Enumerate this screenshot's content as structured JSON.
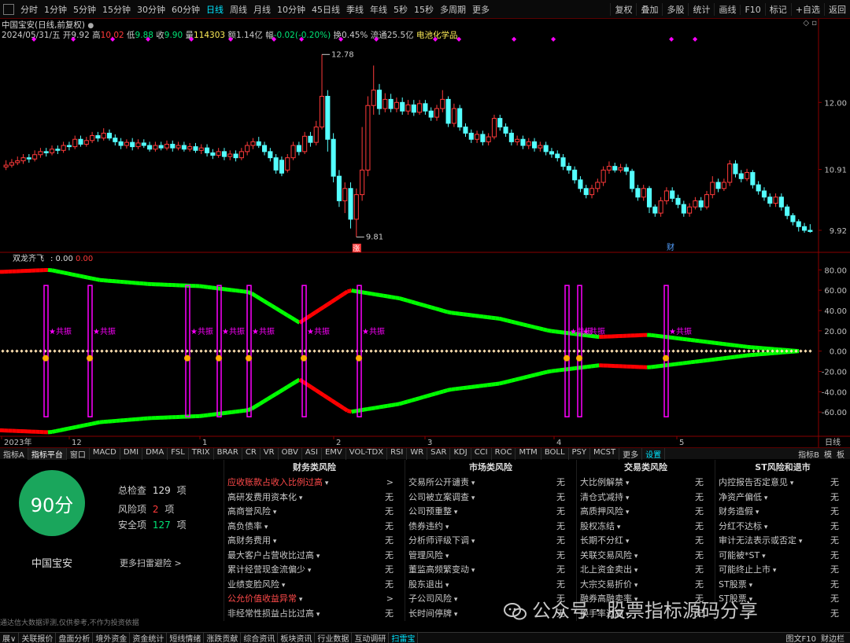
{
  "colors": {
    "up": "#ff3a3a",
    "down": "#54ffff",
    "red_line": "#ff0000",
    "green_line": "#00ff00",
    "magenta": "#ff00ff",
    "score_green": "#1aa65c",
    "orange": "#ffaa00",
    "cyan": "#00e5ff"
  },
  "topbar": {
    "periods": [
      "分时",
      "1分钟",
      "5分钟",
      "15分钟",
      "30分钟",
      "60分钟",
      "日线",
      "周线",
      "月线",
      "10分钟",
      "45日线",
      "季线",
      "年线",
      "5秒",
      "15秒",
      "多周期",
      "更多"
    ],
    "active": "日线",
    "right": [
      "复权",
      "叠加",
      "多股",
      "统计",
      "画线",
      "F10",
      "标记",
      "+自选",
      "返回"
    ]
  },
  "info": {
    "title": "中国宝安(日线,前复权)",
    "date": "2024/05/31/五",
    "open_label": "开",
    "open": "9.92",
    "high_label": "高",
    "high": "10.02",
    "low_label": "低",
    "low": "9.88",
    "close_label": "收",
    "close": "9.90",
    "vol_label": "量",
    "vol": "114303",
    "amount_label": "额",
    "amount": "1.14亿",
    "change_label": "幅",
    "change": "-0.02(-0.20%)",
    "turnover_label": "换",
    "turnover": "0.45%",
    "float_label": "流通",
    "float": "25.5亿",
    "sector": "电池化学品"
  },
  "price_axis": [
    "12.00",
    "10.91",
    "9.92"
  ],
  "price_marks": {
    "high": "12.78",
    "low": "9.81",
    "low_tag": "涨",
    "fin_tag": "财"
  },
  "indicator": {
    "name": "双龙齐飞",
    "value1": "0.00",
    "value2": "0.00",
    "resonance_label": "共振",
    "axis": [
      "80.00",
      "60.00",
      "40.00",
      "20.00",
      "0.00",
      "-20.00",
      "-40.00",
      "-60.00"
    ]
  },
  "time_axis": {
    "labels": [
      "2023年",
      "12",
      "1",
      "2",
      "3",
      "4",
      "5"
    ],
    "right_label": "日线"
  },
  "chart_data": {
    "type": "candlestick",
    "title": "中国宝安(日线,前复权)",
    "ylim": [
      9.6,
      12.95
    ],
    "high_marker": 12.78,
    "low_marker": 9.81,
    "candles": [
      [
        10.95,
        10.98,
        11.06,
        10.9
      ],
      [
        10.98,
        11.02,
        11.08,
        10.94
      ],
      [
        11.02,
        11.05,
        11.12,
        10.98
      ],
      [
        11.05,
        11.1,
        11.16,
        11.0
      ],
      [
        11.1,
        11.08,
        11.16,
        11.02
      ],
      [
        11.08,
        11.15,
        11.22,
        11.04
      ],
      [
        11.15,
        11.2,
        11.26,
        11.1
      ],
      [
        11.2,
        11.18,
        11.26,
        11.12
      ],
      [
        11.18,
        11.24,
        11.3,
        11.14
      ],
      [
        11.24,
        11.22,
        11.3,
        11.16
      ],
      [
        11.22,
        11.3,
        11.36,
        11.18
      ],
      [
        11.3,
        11.28,
        11.36,
        11.22
      ],
      [
        11.28,
        11.4,
        11.46,
        11.24
      ],
      [
        11.4,
        11.32,
        11.46,
        11.28
      ],
      [
        11.32,
        11.38,
        11.44,
        11.28
      ],
      [
        11.38,
        11.46,
        11.52,
        11.34
      ],
      [
        11.46,
        11.42,
        11.52,
        11.36
      ],
      [
        11.42,
        11.5,
        11.58,
        11.38
      ],
      [
        11.5,
        11.42,
        11.56,
        11.38
      ],
      [
        11.42,
        11.36,
        11.48,
        11.3
      ],
      [
        11.36,
        11.3,
        11.42,
        11.24
      ],
      [
        11.3,
        11.35,
        11.4,
        11.25
      ],
      [
        11.35,
        11.28,
        11.42,
        11.22
      ],
      [
        11.28,
        11.34,
        11.4,
        11.24
      ],
      [
        11.34,
        11.3,
        11.4,
        11.26
      ],
      [
        11.3,
        11.24,
        11.36,
        11.2
      ],
      [
        11.24,
        11.3,
        11.36,
        11.2
      ],
      [
        11.3,
        11.26,
        11.36,
        11.22
      ],
      [
        11.26,
        11.32,
        11.38,
        11.22
      ],
      [
        11.32,
        11.26,
        11.38,
        11.2
      ],
      [
        11.26,
        11.3,
        11.36,
        11.22
      ],
      [
        11.3,
        11.24,
        11.36,
        11.2
      ],
      [
        11.24,
        11.28,
        11.34,
        11.2
      ],
      [
        11.28,
        11.22,
        11.34,
        11.18
      ],
      [
        11.22,
        11.26,
        11.32,
        11.16
      ],
      [
        11.26,
        11.18,
        11.32,
        11.12
      ],
      [
        11.18,
        11.14,
        11.24,
        11.08
      ],
      [
        11.14,
        11.2,
        11.26,
        11.1
      ],
      [
        11.2,
        11.12,
        11.26,
        11.06
      ],
      [
        11.12,
        11.16,
        11.22,
        11.06
      ],
      [
        11.16,
        11.1,
        11.22,
        11.04
      ],
      [
        11.1,
        11.2,
        11.26,
        11.06
      ],
      [
        11.2,
        11.3,
        11.36,
        11.14
      ],
      [
        11.3,
        11.36,
        11.42,
        11.24
      ],
      [
        11.36,
        11.3,
        11.44,
        11.26
      ],
      [
        11.3,
        11.2,
        11.36,
        11.14
      ],
      [
        11.2,
        11.1,
        11.26,
        11.04
      ],
      [
        11.1,
        10.9,
        11.16,
        10.84
      ],
      [
        11.06,
        10.85,
        11.12,
        10.8
      ],
      [
        10.9,
        11.1,
        11.16,
        10.86
      ],
      [
        11.1,
        11.3,
        11.36,
        11.06
      ],
      [
        11.3,
        11.2,
        11.36,
        11.14
      ],
      [
        11.2,
        11.45,
        11.52,
        11.16
      ],
      [
        11.45,
        11.35,
        11.52,
        11.28
      ],
      [
        11.35,
        11.6,
        11.7,
        11.3
      ],
      [
        11.6,
        12.1,
        12.78,
        11.56
      ],
      [
        12.1,
        11.4,
        12.2,
        11.2
      ],
      [
        11.4,
        10.8,
        11.5,
        10.7
      ],
      [
        10.8,
        10.4,
        10.9,
        10.3
      ],
      [
        10.4,
        10.6,
        10.7,
        10.2
      ],
      [
        10.6,
        10.1,
        10.7,
        9.95
      ],
      [
        10.1,
        10.5,
        10.6,
        9.81
      ],
      [
        10.5,
        10.9,
        11.6,
        10.4
      ],
      [
        10.9,
        11.95,
        12.1,
        10.8
      ],
      [
        11.95,
        12.2,
        12.6,
        11.8
      ],
      [
        12.2,
        11.9,
        12.3,
        11.8
      ],
      [
        11.9,
        12.05,
        12.15,
        11.84
      ],
      [
        12.05,
        11.9,
        12.14,
        11.84
      ],
      [
        11.9,
        12.0,
        12.08,
        11.84
      ],
      [
        12.0,
        11.86,
        12.08,
        11.8
      ],
      [
        11.86,
        11.96,
        12.04,
        11.8
      ],
      [
        11.96,
        11.84,
        12.04,
        11.78
      ],
      [
        11.84,
        11.98,
        12.04,
        11.8
      ],
      [
        11.98,
        11.86,
        12.04,
        11.8
      ],
      [
        11.86,
        11.76,
        11.92,
        11.7
      ],
      [
        11.76,
        11.9,
        11.96,
        11.7
      ],
      [
        11.9,
        12.05,
        12.2,
        11.84
      ],
      [
        12.05,
        11.66,
        12.1,
        11.6
      ],
      [
        11.66,
        11.9,
        11.98,
        11.6
      ],
      [
        11.9,
        11.6,
        11.96,
        11.54
      ],
      [
        11.6,
        11.5,
        11.66,
        11.44
      ],
      [
        11.5,
        11.4,
        11.56,
        11.34
      ],
      [
        11.4,
        11.48,
        11.54,
        11.34
      ],
      [
        11.48,
        11.36,
        11.54,
        11.3
      ],
      [
        11.36,
        11.44,
        11.5,
        11.3
      ],
      [
        11.44,
        11.74,
        11.8,
        11.4
      ],
      [
        11.74,
        11.6,
        11.8,
        11.54
      ],
      [
        11.6,
        11.5,
        11.66,
        11.44
      ],
      [
        11.5,
        11.36,
        11.56,
        11.3
      ],
      [
        11.36,
        11.4,
        11.46,
        11.3
      ],
      [
        11.4,
        11.3,
        11.46,
        11.24
      ],
      [
        11.3,
        11.36,
        11.42,
        11.24
      ],
      [
        11.36,
        11.26,
        11.42,
        11.2
      ],
      [
        11.26,
        11.3,
        11.36,
        11.2
      ],
      [
        11.3,
        11.2,
        11.36,
        11.14
      ],
      [
        11.2,
        11.16,
        11.26,
        11.1
      ],
      [
        11.16,
        11.1,
        11.22,
        11.04
      ],
      [
        11.1,
        10.96,
        11.16,
        10.9
      ],
      [
        10.96,
        10.9,
        11.02,
        10.84
      ],
      [
        10.9,
        10.74,
        10.96,
        10.68
      ],
      [
        10.74,
        10.6,
        10.8,
        10.54
      ],
      [
        10.6,
        10.5,
        10.66,
        10.44
      ],
      [
        10.5,
        10.6,
        10.66,
        10.44
      ],
      [
        10.6,
        10.7,
        10.76,
        10.54
      ],
      [
        10.7,
        10.9,
        10.96,
        10.64
      ],
      [
        10.9,
        10.96,
        11.04,
        10.84
      ],
      [
        10.96,
        10.9,
        11.02,
        10.86
      ],
      [
        10.9,
        10.94,
        11.0,
        10.86
      ],
      [
        10.94,
        10.88,
        11.0,
        10.82
      ],
      [
        10.88,
        10.6,
        10.92,
        10.54
      ],
      [
        10.6,
        10.46,
        10.66,
        10.4
      ],
      [
        10.46,
        10.6,
        10.66,
        10.4
      ],
      [
        10.6,
        10.3,
        10.64,
        10.2
      ],
      [
        10.3,
        10.2,
        10.34,
        10.14
      ],
      [
        10.2,
        10.4,
        10.46,
        10.14
      ],
      [
        10.4,
        10.56,
        10.62,
        10.34
      ],
      [
        10.56,
        10.44,
        10.62,
        10.38
      ],
      [
        10.44,
        10.34,
        10.5,
        10.28
      ],
      [
        10.34,
        10.2,
        10.4,
        10.14
      ],
      [
        10.2,
        10.3,
        10.36,
        10.14
      ],
      [
        10.3,
        10.4,
        10.46,
        10.26
      ],
      [
        10.4,
        10.3,
        10.46,
        10.24
      ],
      [
        10.3,
        10.5,
        10.56,
        10.26
      ],
      [
        10.5,
        10.7,
        10.8,
        10.44
      ],
      [
        10.7,
        10.6,
        10.76,
        10.54
      ],
      [
        10.6,
        10.7,
        10.76,
        10.56
      ],
      [
        10.7,
        11.0,
        11.06,
        10.64
      ],
      [
        11.0,
        10.84,
        11.06,
        10.78
      ],
      [
        10.84,
        10.76,
        10.9,
        10.7
      ],
      [
        10.76,
        10.86,
        10.92,
        10.72
      ],
      [
        10.86,
        10.66,
        10.9,
        10.6
      ],
      [
        10.66,
        10.56,
        10.72,
        10.5
      ],
      [
        10.56,
        10.46,
        10.62,
        10.4
      ],
      [
        10.46,
        10.36,
        10.52,
        10.3
      ],
      [
        10.36,
        10.46,
        10.52,
        10.3
      ],
      [
        10.46,
        10.3,
        10.52,
        10.24
      ],
      [
        10.3,
        10.16,
        10.34,
        10.1
      ],
      [
        10.16,
        10.06,
        10.2,
        10.0
      ],
      [
        10.06,
        9.98,
        10.1,
        9.9
      ],
      [
        9.98,
        9.92,
        10.04,
        9.88
      ],
      [
        9.92,
        9.9,
        10.02,
        9.88
      ]
    ],
    "indicator_series": [
      {
        "name": "红线",
        "values": [
          78,
          80,
          70,
          66,
          64,
          58,
          28,
          60,
          52,
          38,
          32,
          20,
          14,
          16,
          10,
          4,
          0
        ]
      },
      {
        "name": "绿线",
        "values": [
          -78,
          -80,
          -70,
          -66,
          -64,
          -58,
          -28,
          -60,
          -52,
          -38,
          -32,
          -20,
          -14,
          -16,
          -10,
          -4,
          0
        ]
      }
    ],
    "ind_ylim": [
      -80,
      88
    ]
  },
  "indicator_tabs": [
    "指标A",
    "指标平台",
    "窗口",
    "MACD",
    "DMI",
    "DMA",
    "FSL",
    "TRIX",
    "BRAR",
    "CR",
    "VR",
    "OBV",
    "ASI",
    "EMV",
    "VOL-TDX",
    "RSI",
    "WR",
    "SAR",
    "KDJ",
    "CCI",
    "ROC",
    "MTM",
    "BOLL",
    "PSY",
    "MCST",
    "更多",
    "设置"
  ],
  "indicator_tabs_right": [
    "指标B",
    "模",
    "板"
  ],
  "risk": {
    "score": "90分",
    "total_label": "总检查",
    "total": "129",
    "unit": "项",
    "risk_label": "风险项",
    "risk": "2",
    "safe_label": "安全项",
    "safe": "127",
    "stock_name": "中国宝安",
    "more": "更多扫雷避险 >",
    "disclaimer": "通达信大数据评测,仅供参考,不作为投资依据",
    "columns": [
      {
        "title": "财务类风险",
        "rows": [
          {
            "label": "应收账款占收入比例过高",
            "value": ">",
            "red": true
          },
          {
            "label": "高研发费用资本化",
            "value": "无"
          },
          {
            "label": "高商誉风险",
            "value": "无"
          },
          {
            "label": "高负债率",
            "value": "无"
          },
          {
            "label": "高财务费用",
            "value": "无"
          },
          {
            "label": "最大客户占营收比过高",
            "value": "无"
          },
          {
            "label": "累计经营现金流偏少",
            "value": "无"
          },
          {
            "label": "业绩变脸风险",
            "value": "无"
          },
          {
            "label": "公允价值收益异常",
            "value": ">",
            "red": true
          },
          {
            "label": "非经常性损益占比过高",
            "value": "无"
          }
        ]
      },
      {
        "title": "市场类风险",
        "rows": [
          {
            "label": "交易所公开谴责",
            "value": "无"
          },
          {
            "label": "公司被立案调查",
            "value": "无"
          },
          {
            "label": "公司预重整",
            "value": "无"
          },
          {
            "label": "债券违约",
            "value": "无"
          },
          {
            "label": "分析师评级下调",
            "value": "无"
          },
          {
            "label": "管理风险",
            "value": "无"
          },
          {
            "label": "董监高频繁变动",
            "value": "无"
          },
          {
            "label": "股东退出",
            "value": "无"
          },
          {
            "label": "子公司风险",
            "value": "无"
          },
          {
            "label": "长时间停牌",
            "value": "无"
          }
        ]
      },
      {
        "title": "交易类风险",
        "rows": [
          {
            "label": "大比例解禁",
            "value": "无"
          },
          {
            "label": "清仓式减持",
            "value": "无"
          },
          {
            "label": "高质押风险",
            "value": "无"
          },
          {
            "label": "股权冻结",
            "value": "无"
          },
          {
            "label": "长期不分红",
            "value": "无"
          },
          {
            "label": "关联交易风险",
            "value": "无"
          },
          {
            "label": "北上资金卖出",
            "value": "无"
          },
          {
            "label": "大宗交易折价",
            "value": "无"
          },
          {
            "label": "融券高融卖率",
            "value": "无"
          },
          {
            "label": "换手率过高",
            "value": "无"
          }
        ]
      },
      {
        "title": "ST风险和退市",
        "rows": [
          {
            "label": "内控报告否定意见",
            "value": "无"
          },
          {
            "label": "净资产偏低",
            "value": "无"
          },
          {
            "label": "财务造假",
            "value": "无"
          },
          {
            "label": "分红不达标",
            "value": "无"
          },
          {
            "label": "审计无法表示或否定",
            "value": "无"
          },
          {
            "label": "可能被*ST",
            "value": "无"
          },
          {
            "label": "可能终止上市",
            "value": "无"
          },
          {
            "label": "ST股票",
            "value": "无"
          },
          {
            "label": "ST股票",
            "value": "无"
          },
          {
            "label": "",
            "value": "无"
          }
        ]
      }
    ]
  },
  "watermark": "公众号 · 股票指标源码分享",
  "bottombar": [
    "展∨",
    "关联报价",
    "盘面分析",
    "境外资金",
    "资金统计",
    "短线情绪",
    "涨跌贡献",
    "综合资讯",
    "板块资讯",
    "行业数据",
    "互动调研",
    "扫雷宝"
  ],
  "bottombar_active": "扫雷宝",
  "bottombar_right": [
    "图文F10",
    "财边栏"
  ]
}
